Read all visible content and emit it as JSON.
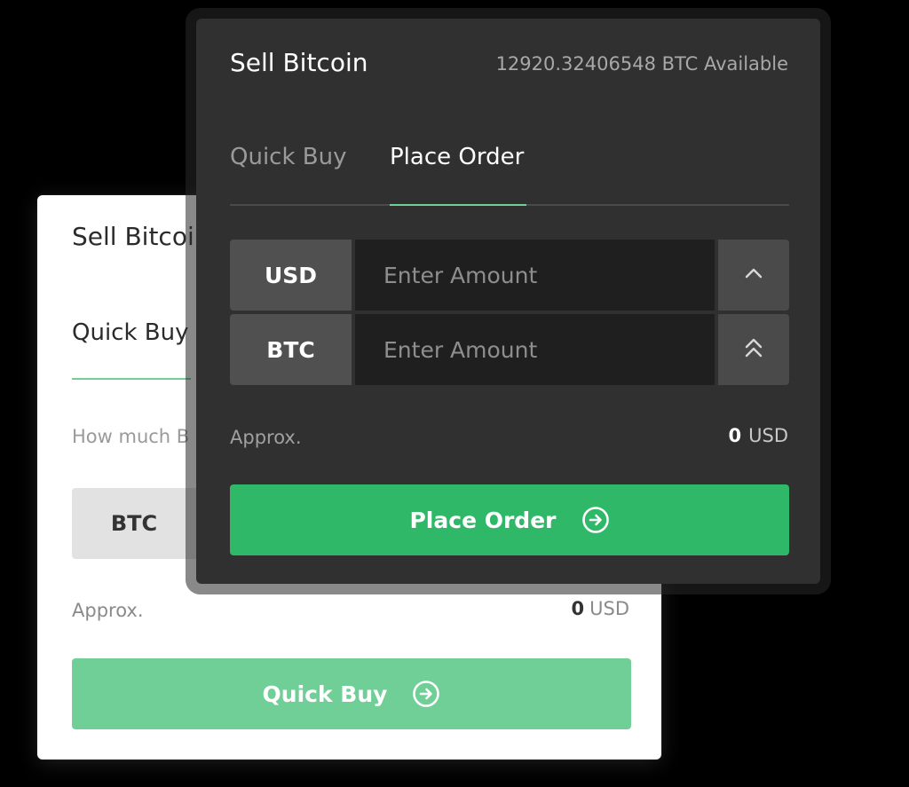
{
  "back_card": {
    "title": "Sell Bitcoi",
    "tab_label": "Quick Buy",
    "prompt": "How much B",
    "currency": "BTC",
    "approx_label": "Approx.",
    "approx_value": "0",
    "approx_unit": "USD",
    "button_label": "Quick Buy"
  },
  "front_card": {
    "title": "Sell Bitcoin",
    "available": "12920.32406548 BTC Available",
    "tabs": [
      {
        "label": "Quick Buy",
        "active": false
      },
      {
        "label": "Place Order",
        "active": true
      }
    ],
    "rows": [
      {
        "currency": "USD",
        "placeholder": "Enter Amount",
        "stepper_icon": "chevron-up-icon"
      },
      {
        "currency": "BTC",
        "placeholder": "Enter Amount",
        "stepper_icon": "double-chevron-up-icon"
      }
    ],
    "approx_label": "Approx.",
    "approx_value": "0",
    "approx_unit": "USD",
    "button_label": "Place Order"
  },
  "colors": {
    "accent_green": "#2eb867",
    "light_green": "#6fcf97",
    "dark_panel": "#303030"
  }
}
